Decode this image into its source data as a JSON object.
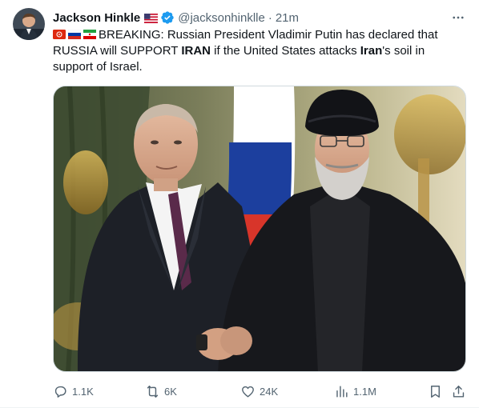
{
  "author": {
    "display_name": "Jackson Hinkle",
    "handle": "@jacksonhinklle",
    "separator": "·",
    "time": "21m"
  },
  "tweet": {
    "seg1": "BREAKING: Russian President Vladimir Putin has declared that RUSSIA will SUPPORT ",
    "bold1": "IRAN",
    "seg2": " if the United States attacks ",
    "bold2": "Iran",
    "seg3": "'s soil in support of Israel."
  },
  "actions": {
    "replies": "1.1K",
    "reposts": "6K",
    "likes": "24K",
    "views": "1.1M"
  },
  "colors": {
    "text": "#0f1419",
    "secondary": "#536471",
    "verified": "#1d9bf0",
    "border": "#cfd9de"
  },
  "icons": [
    "avatar",
    "us-flag-icon",
    "verified-badge-icon",
    "more-icon",
    "hk-flag-icon",
    "russia-flag-icon",
    "iran-flag-icon",
    "reply-icon",
    "repost-icon",
    "like-icon",
    "views-icon",
    "bookmark-icon",
    "share-icon"
  ]
}
